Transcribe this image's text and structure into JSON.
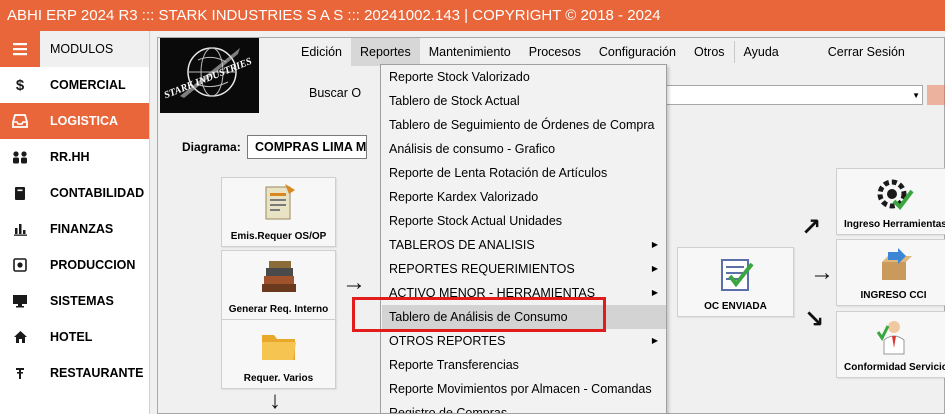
{
  "titlebar": {
    "text": "ABHI ERP 2024 R3 ::: STARK INDUSTRIES S A S ::: 20241002.143 | COPYRIGHT ©  2018 - 2024"
  },
  "sidebar": {
    "items": [
      {
        "label": "MODULOS",
        "icon": "hamburger-icon"
      },
      {
        "label": "COMERCIAL",
        "icon": "dollar-icon"
      },
      {
        "label": "LOGISTICA",
        "icon": "inbox-icon"
      },
      {
        "label": "RR.HH",
        "icon": "people-icon"
      },
      {
        "label": "CONTABILIDAD",
        "icon": "book-icon"
      },
      {
        "label": "FINANZAS",
        "icon": "bar-chart-icon"
      },
      {
        "label": "PRODUCCION",
        "icon": "gear-box-icon"
      },
      {
        "label": "SISTEMAS",
        "icon": "desktop-icon"
      },
      {
        "label": "HOTEL",
        "icon": "home-icon"
      },
      {
        "label": "RESTAURANTE",
        "icon": "pin-icon"
      }
    ],
    "active": "LOGISTICA"
  },
  "logo": {
    "text": "STARK INDUSTRIES"
  },
  "menubar": {
    "items": [
      "Edición",
      "Reportes",
      "Mantenimiento",
      "Procesos",
      "Configuración",
      "Otros",
      "Ayuda",
      "Cerrar Sesión"
    ],
    "open": "Reportes"
  },
  "search": {
    "label": "Buscar O"
  },
  "diagrama": {
    "label": "Diagrama:",
    "value": "COMPRAS LIMA M"
  },
  "tiles": {
    "emis_requer": "Emis.Requer OS/OP",
    "generar_req": "Generar Req. Interno",
    "requer_varios": "Requer. Varios",
    "oc_enviada": "OC ENVIADA",
    "ingreso_herramientas": "Ingreso Herramientas",
    "ingreso_cci": "INGRESO CCI",
    "conformidad_servicio": "Conformidad Servicio"
  },
  "reportes_menu": {
    "items": [
      {
        "label": "Reporte Stock Valorizado",
        "submenu": false
      },
      {
        "label": "Tablero de Stock Actual",
        "submenu": false
      },
      {
        "label": "Tablero de Seguimiento de Órdenes de Compra",
        "submenu": false
      },
      {
        "label": "Análisis de consumo - Grafico",
        "submenu": false
      },
      {
        "label": "Reporte de Lenta Rotación de Artículos",
        "submenu": false
      },
      {
        "label": "Reporte Kardex Valorizado",
        "submenu": false
      },
      {
        "label": "Reporte Stock Actual Unidades",
        "submenu": false
      },
      {
        "label": "TABLEROS DE ANALISIS",
        "submenu": true
      },
      {
        "label": "REPORTES REQUERIMIENTOS",
        "submenu": true
      },
      {
        "label": "ACTIVO MENOR - HERRAMIENTAS",
        "submenu": true
      },
      {
        "label": "Tablero de Análisis de Consumo",
        "submenu": false
      },
      {
        "label": "OTROS REPORTES",
        "submenu": true
      },
      {
        "label": "Reporte Transferencias",
        "submenu": false
      },
      {
        "label": "Reporte Movimientos por Almacen - Comandas",
        "submenu": false
      },
      {
        "label": "Registro de Compras",
        "submenu": false
      }
    ],
    "highlighted": "Tablero de Análisis de Consumo"
  },
  "colors": {
    "accent": "#e8663a",
    "highlight_border": "#e21b1b",
    "menu_bg": "#f2f2f2"
  }
}
